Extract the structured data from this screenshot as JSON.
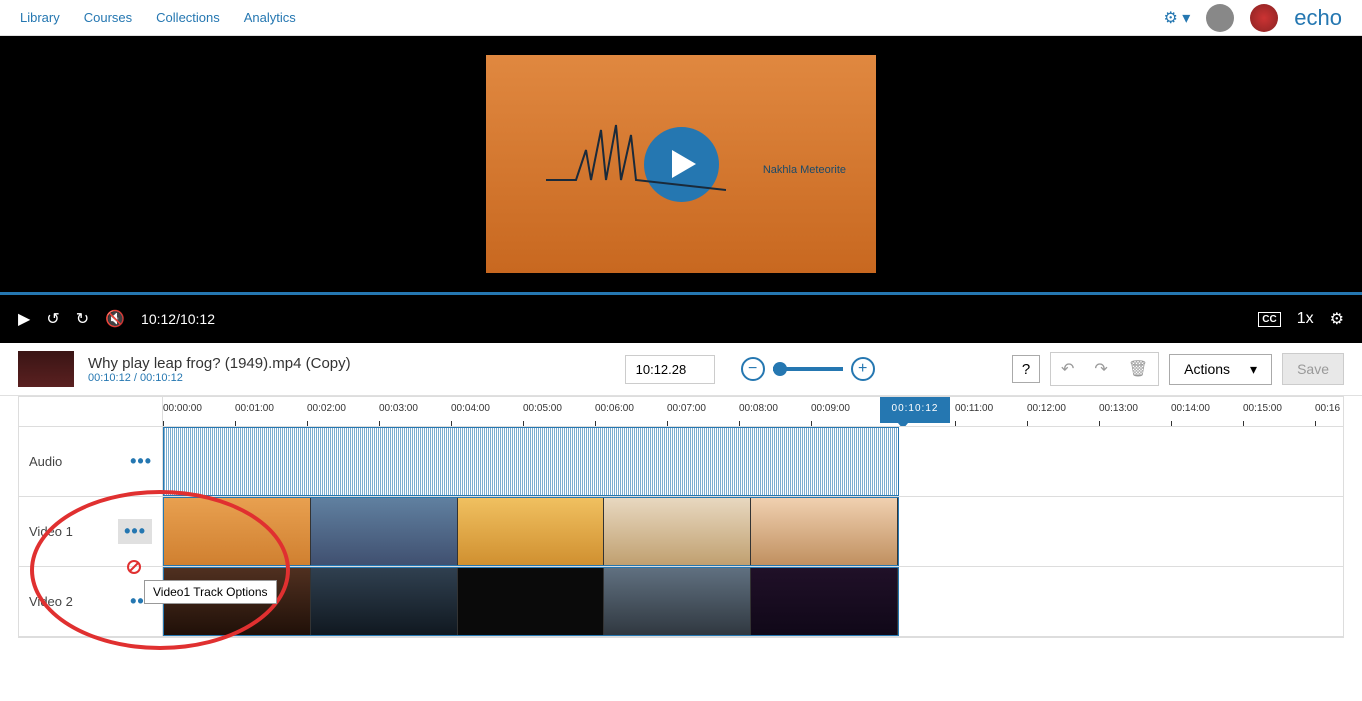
{
  "nav": {
    "library": "Library",
    "courses": "Courses",
    "collections": "Collections",
    "analytics": "Analytics"
  },
  "logo": "echo",
  "preview": {
    "meteorite": "Nakhla Meteorite"
  },
  "player": {
    "time": "10:12/10:12",
    "speed": "1x",
    "cc": "CC"
  },
  "clip": {
    "title": "Why play leap frog? (1949).mp4 (Copy)",
    "time": "00:10:12 / 00:10:12",
    "timecode": "10:12.28"
  },
  "actions": "Actions",
  "save": "Save",
  "playhead": "00:10:12",
  "tracks": {
    "audio": "Audio",
    "video1": "Video 1",
    "video2": "Video 2"
  },
  "tooltip": "Video1 Track Options",
  "ticks": [
    "00:00:00",
    "00:01:00",
    "00:02:00",
    "00:03:00",
    "00:04:00",
    "00:05:00",
    "00:06:00",
    "00:07:00",
    "00:08:00",
    "00:09:00",
    "00:11:00",
    "00:12:00",
    "00:13:00",
    "00:14:00",
    "00:15:00",
    "00:16"
  ]
}
